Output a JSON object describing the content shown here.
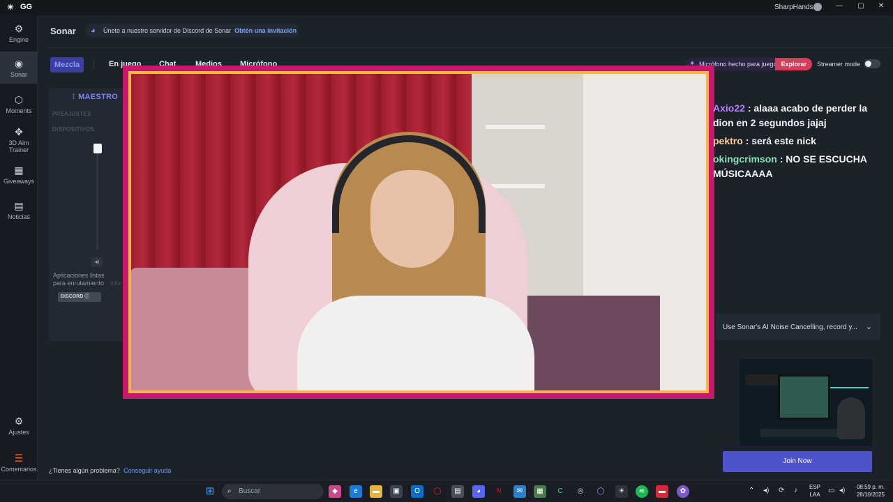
{
  "titlebar": {
    "logo": "☀",
    "app_name": "GG",
    "username": "SharpHands1",
    "minimize": "—",
    "maximize": "▢",
    "close": "✕"
  },
  "nav": [
    {
      "label": "Engine",
      "icon": "⚙"
    },
    {
      "label": "Sonar",
      "icon": "◉"
    },
    {
      "label": "Moments",
      "icon": "⬡"
    },
    {
      "label": "3D Aim Trainer",
      "icon": "✥"
    },
    {
      "label": "Giveaways",
      "icon": "▦"
    },
    {
      "label": "Noticias",
      "icon": "▤"
    },
    {
      "label": "Ajustes",
      "icon": "⚙"
    },
    {
      "label": "Comentarios",
      "icon": "☰"
    }
  ],
  "header": {
    "title": "Sonar",
    "banner_text": "Únete a nuestro servidor de Discord de Sonar",
    "banner_link": "Obtén una invitación"
  },
  "tabs": [
    "Mezcla",
    "En juego",
    "Chat",
    "Medios",
    "Micrófono"
  ],
  "promo": {
    "text": "Micrófono hecho para juegos",
    "action": "Explorar"
  },
  "streamer_mode_label": "Streamer mode",
  "mixer": {
    "master_label": "MAESTRO",
    "presets_label": "PREAJUSTES",
    "devices_label": "DISPOSITIVOS",
    "apps_note": "Aplicaciones listas para enrutamiento",
    "info_label": "infor",
    "discord_chip": "DISCORD"
  },
  "chat": [
    {
      "name": "Axio22",
      "message": ": alaaa acabo de perder la",
      "cont": "dion en 2 segundos jajaj"
    },
    {
      "name": "pektro",
      "message": ": será este nick",
      "cont": ""
    },
    {
      "name": "okingcrimson",
      "message": ": NO SE ESCUCHA",
      "cont": "MÚSICAAAA"
    }
  ],
  "ad": {
    "text": "Use Sonar's AI Noise Cancelling, record y...",
    "button": "Join Now"
  },
  "help": {
    "text": "¿Tienes algún problema?",
    "link": "Conseguir ayuda"
  },
  "taskbar": {
    "search_placeholder": "Buscar",
    "lang_line1": "ESP",
    "lang_line2": "LAA",
    "time": "08:59 p. m.",
    "date": "28/10/2025"
  },
  "colors": {
    "accent": "#7b86ff",
    "join_button": "#4e53c9",
    "explore": "#d83c57"
  }
}
